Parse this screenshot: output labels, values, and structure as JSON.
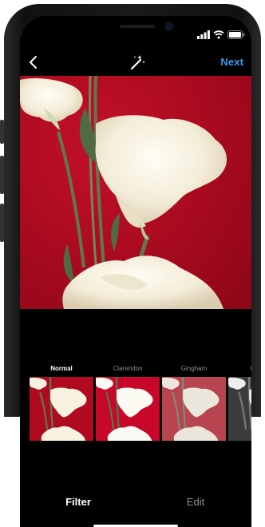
{
  "header": {
    "back_icon": "chevron-left-icon",
    "magic_icon": "magic-wand-icon",
    "next_label": "Next",
    "accent": "#3897f0"
  },
  "status_bar": {
    "icons": [
      "signal-icon",
      "wifi-icon",
      "battery-icon"
    ]
  },
  "filters": [
    {
      "label": "Normal",
      "selected": true
    },
    {
      "label": "Clarendon",
      "selected": false
    },
    {
      "label": "Gingham",
      "selected": false
    },
    {
      "label": "M",
      "selected": false
    }
  ],
  "tabs": [
    {
      "label": "Filter",
      "active": true
    },
    {
      "label": "Edit",
      "active": false
    }
  ],
  "colors": {
    "background": "#000000",
    "photo_red": "#b0081f",
    "active_text": "#ffffff",
    "inactive_text": "#8e8e8e"
  }
}
